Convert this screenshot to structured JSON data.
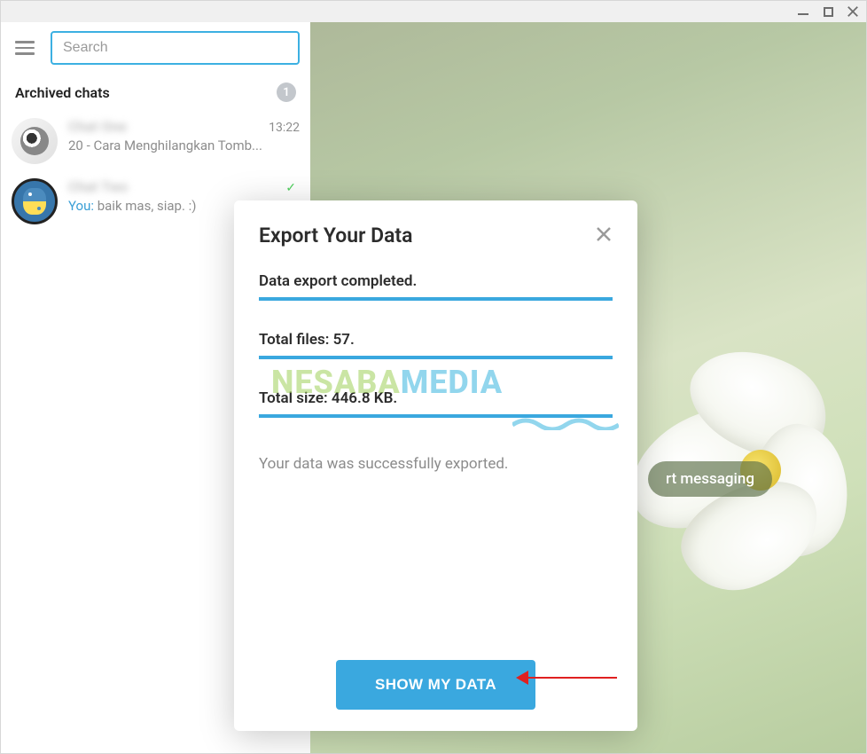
{
  "window": {
    "minimize_name": "minimize",
    "maximize_name": "maximize",
    "close_name": "close"
  },
  "sidebar": {
    "search_placeholder": "Search",
    "archived_label": "Archived chats",
    "archived_count": "1",
    "chats": [
      {
        "name": "Chat One",
        "time": "13:22",
        "preview": "20 - Cara Menghilangkan Tomb..."
      },
      {
        "name": "Chat Two",
        "you_prefix": "You: ",
        "preview": "baik mas, siap. :)",
        "read": true
      }
    ]
  },
  "main": {
    "start_messaging_partial": "rt messaging"
  },
  "modal": {
    "title": "Export Your Data",
    "status_line": "Data export completed.",
    "total_files_line": "Total files: 57.",
    "total_size_line": "Total size: 446.8 KB.",
    "success_msg": "Your data was successfully exported.",
    "show_button": "SHOW MY DATA"
  },
  "watermark": {
    "part1": "NESABA",
    "part2": "MEDIA"
  }
}
